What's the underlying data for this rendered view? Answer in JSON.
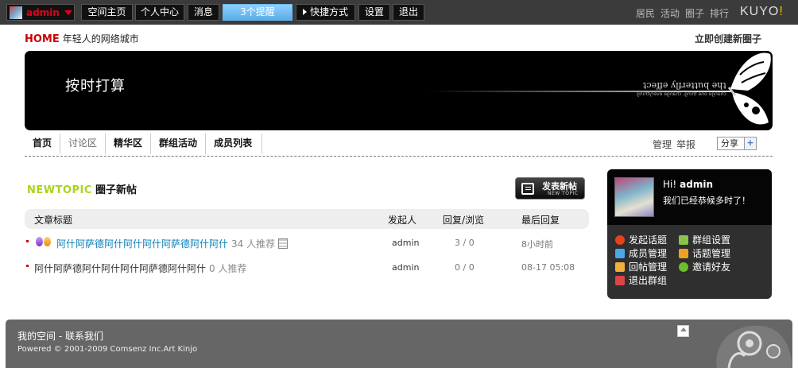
{
  "topbar": {
    "user_name": "admin",
    "nav": [
      "空间主页",
      "个人中心",
      "消息"
    ],
    "reminder": "3个提醒",
    "quick": "快捷方式",
    "settings": "设置",
    "logout": "退出",
    "right_links": [
      "居民",
      "活动",
      "圈子",
      "排行"
    ],
    "brand": "KUYO",
    "brand_bang": "!"
  },
  "header": {
    "home": "HOME",
    "tagline": "年轻人的网络城市",
    "create_group": "立即创建新圈子"
  },
  "banner": {
    "title": "按时打算",
    "butterfly_text": "the butterfly effect",
    "butterfly_sub": "change one thing, change everything"
  },
  "tabs": [
    "首页",
    "讨论区",
    "精华区",
    "群组活动",
    "成员列表"
  ],
  "tab_actions": [
    "管理",
    "举报"
  ],
  "share": "分享",
  "share_plus": "+",
  "section": {
    "en": "NEWTOPIC",
    "cn": "圈子新帖"
  },
  "post_button": {
    "label": "发表新帖",
    "sub": "NEW TOPIC"
  },
  "table": {
    "headers": [
      "文章标题",
      "发起人",
      "回复/浏览",
      "最后回复"
    ],
    "rows": [
      {
        "title": "阿什阿萨德阿什阿什阿什阿萨德阿什阿什",
        "rec": "34 人推荐",
        "author": "admin",
        "stats": "3 / 0",
        "last": "8小时前"
      },
      {
        "title": "阿什阿萨德阿什阿什阿什阿萨德阿什阿什",
        "rec": "0 人推荐",
        "author": "admin",
        "stats": "0 / 0",
        "last": "08-17 05:08"
      }
    ]
  },
  "sidebar": {
    "hi": "Hi!",
    "name": "admin",
    "message": "我们已经恭候多时了！",
    "links": [
      "发起话题",
      "群组设置",
      "成员管理",
      "话题管理",
      "回帖管理",
      "邀请好友",
      "退出群组"
    ]
  },
  "footer": {
    "my_space": "我的空间",
    "contact": "- 联系我们",
    "copyright": "Powered © 2001-2009 Comsenz Inc.Art Kinjo"
  },
  "colors": {
    "topbar_bg": "#3b3b3b",
    "accent_red": "#e2001a",
    "link_blue": "#0a7fb7",
    "newtopic_green": "#aad41a",
    "footer_bg": "#666666"
  }
}
